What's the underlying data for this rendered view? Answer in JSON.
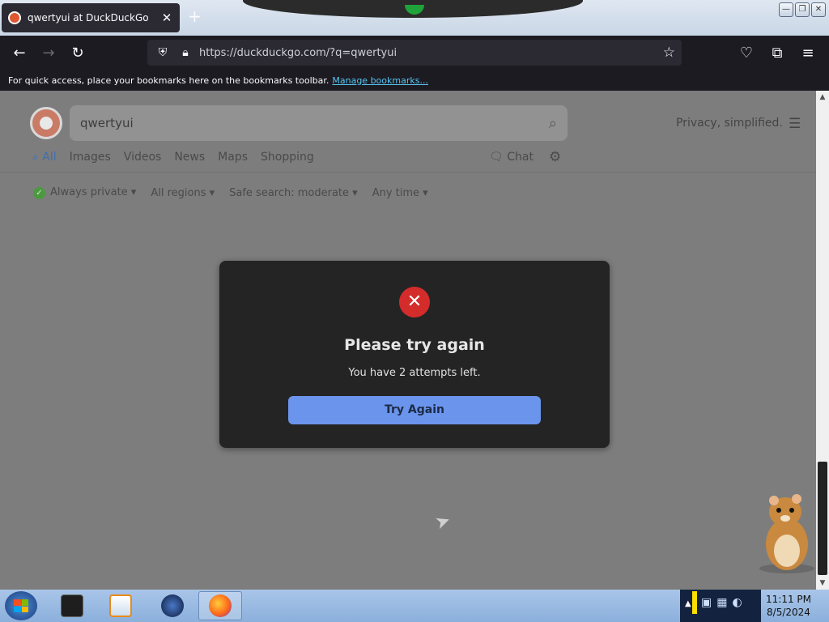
{
  "browser": {
    "tab": {
      "title": "qwertyui at DuckDuckGo",
      "close": "✕"
    },
    "new_tab": "+",
    "window_controls": {
      "minimize": "—",
      "restore": "❐",
      "close": "✕"
    },
    "nav": {
      "back": "←",
      "forward": "→",
      "reload": "↻"
    },
    "url": "https://duckduckgo.com/?q=qwertyui",
    "bookmarks_bar": {
      "text": "For quick access, place your bookmarks here on the bookmarks toolbar.",
      "link": "Manage bookmarks..."
    }
  },
  "ddg": {
    "query": "qwertyui",
    "tagline": "Privacy, simplified.",
    "tabs": [
      "All",
      "Images",
      "Videos",
      "News",
      "Maps",
      "Shopping"
    ],
    "chat": "Chat",
    "filters": {
      "privacy": "Always private ▾",
      "region": "All regions ▾",
      "safe_search": "Safe search: moderate ▾",
      "time": "Any time ▾"
    }
  },
  "dialog": {
    "title": "Please try again",
    "message": "You have 2 attempts left.",
    "button": "Try Again",
    "icon": "✕"
  },
  "taskbar": {
    "time": "11:11 PM",
    "date": "8/5/2024"
  },
  "colors": {
    "accent_blue": "#6b94ec",
    "error_red": "#d42b2b",
    "ddg_orange": "#de5833"
  }
}
